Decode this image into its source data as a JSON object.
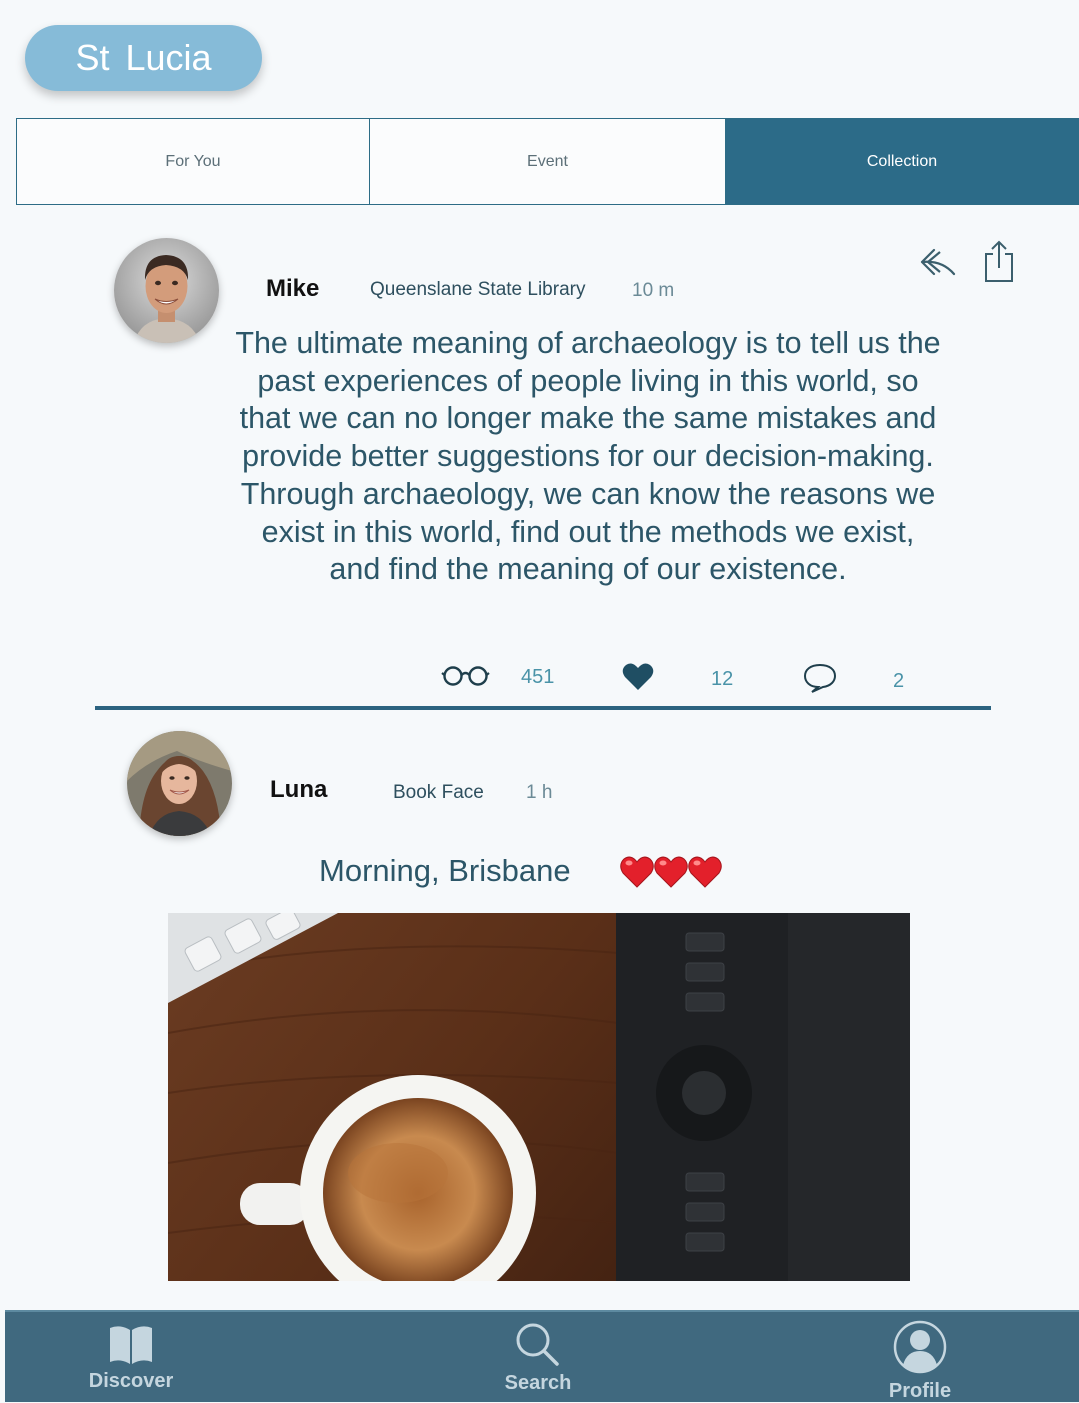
{
  "header": {
    "location": "St  Lucia"
  },
  "tabs": [
    {
      "label": "For You",
      "active": false
    },
    {
      "label": "Event",
      "active": false
    },
    {
      "label": "Collection",
      "active": true
    }
  ],
  "posts": [
    {
      "user": "Mike",
      "source": "Queenslane State Library",
      "time": "10 m",
      "text": "The ultimate meaning of archaeology is to tell us the past experiences of people living in this world, so that we can no longer make the same mistakes and provide better suggestions for our decision-making. Through archaeology, we can know the reasons we exist in this world, find out the methods we exist, and find the meaning of our existence.",
      "stats": {
        "views": "451",
        "likes": "12",
        "comments": "2"
      }
    },
    {
      "user": "Luna",
      "source": "Book Face",
      "time": "1 h",
      "caption": "Morning, Brisbane"
    }
  ],
  "nav": [
    {
      "label": "Discover",
      "icon": "book-icon"
    },
    {
      "label": "Search",
      "icon": "search-icon"
    },
    {
      "label": "Profile",
      "icon": "profile-icon"
    }
  ],
  "colors": {
    "accent": "#2c6b88",
    "pill": "#86bbd8",
    "nav_bg": "#40697f"
  }
}
